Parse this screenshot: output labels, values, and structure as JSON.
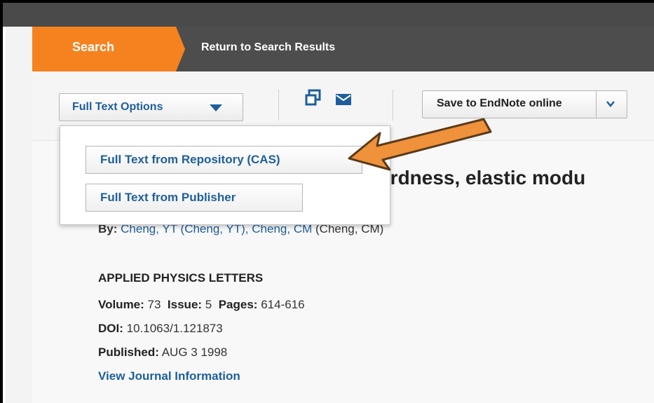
{
  "nav": {
    "search_tab": "Search",
    "return_link": "Return to Search Results"
  },
  "toolbar": {
    "full_text_options": "Full Text Options",
    "print_icon": "print-icon",
    "email_icon": "email-icon",
    "save_to_endnote": "Save to EndNote online"
  },
  "dropdown": {
    "items": [
      "Full Text from Repository (CAS)",
      "Full Text from Publisher"
    ]
  },
  "article": {
    "title_fragment": "hardness, elastic modu",
    "by_label": "By:",
    "author1": "Cheng, YT",
    "author1_full": "(Cheng, YT),",
    "author2": "Cheng, CM",
    "author2_full": "(Cheng, CM)",
    "journal": "APPLIED PHYSICS LETTERS",
    "volume_label": "Volume:",
    "volume": "73",
    "issue_label": "Issue:",
    "issue": "5",
    "pages_label": "Pages:",
    "pages": "614-616",
    "doi_label": "DOI:",
    "doi": "10.1063/1.121873",
    "published_label": "Published:",
    "published": "AUG 3 1998",
    "view_journal": "View Journal Information"
  },
  "colors": {
    "accent_orange": "#f5821f",
    "nav_dark": "#4d4d4d",
    "link_blue": "#1e5f9b",
    "annotation_arrow": "#f0913b"
  }
}
